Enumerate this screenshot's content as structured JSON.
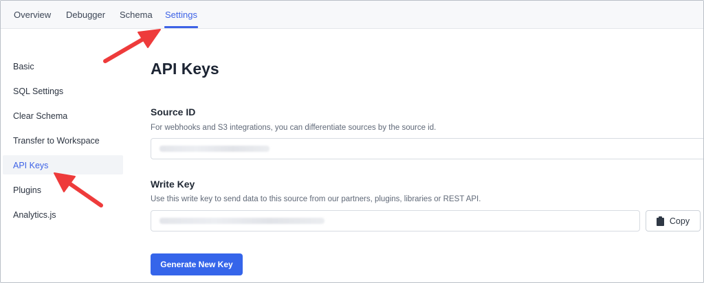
{
  "tabs": [
    {
      "label": "Overview"
    },
    {
      "label": "Debugger"
    },
    {
      "label": "Schema"
    },
    {
      "label": "Settings"
    }
  ],
  "sidebar": {
    "items": [
      {
        "label": "Basic"
      },
      {
        "label": "SQL Settings"
      },
      {
        "label": "Clear Schema"
      },
      {
        "label": "Transfer to Workspace"
      },
      {
        "label": "API Keys"
      },
      {
        "label": "Plugins"
      },
      {
        "label": "Analytics.js"
      }
    ]
  },
  "main": {
    "title": "API Keys",
    "source_id": {
      "label": "Source ID",
      "description": "For webhooks and S3 integrations, you can differentiate sources by the source id."
    },
    "write_key": {
      "label": "Write Key",
      "description": "Use this write key to send data to this source from our partners, plugins, libraries or REST API.",
      "copy_label": "Copy"
    },
    "generate_label": "Generate New Key"
  },
  "colors": {
    "accent": "#3d62e6",
    "button": "#3565ea",
    "annotation_arrow": "#ee3b3b"
  }
}
